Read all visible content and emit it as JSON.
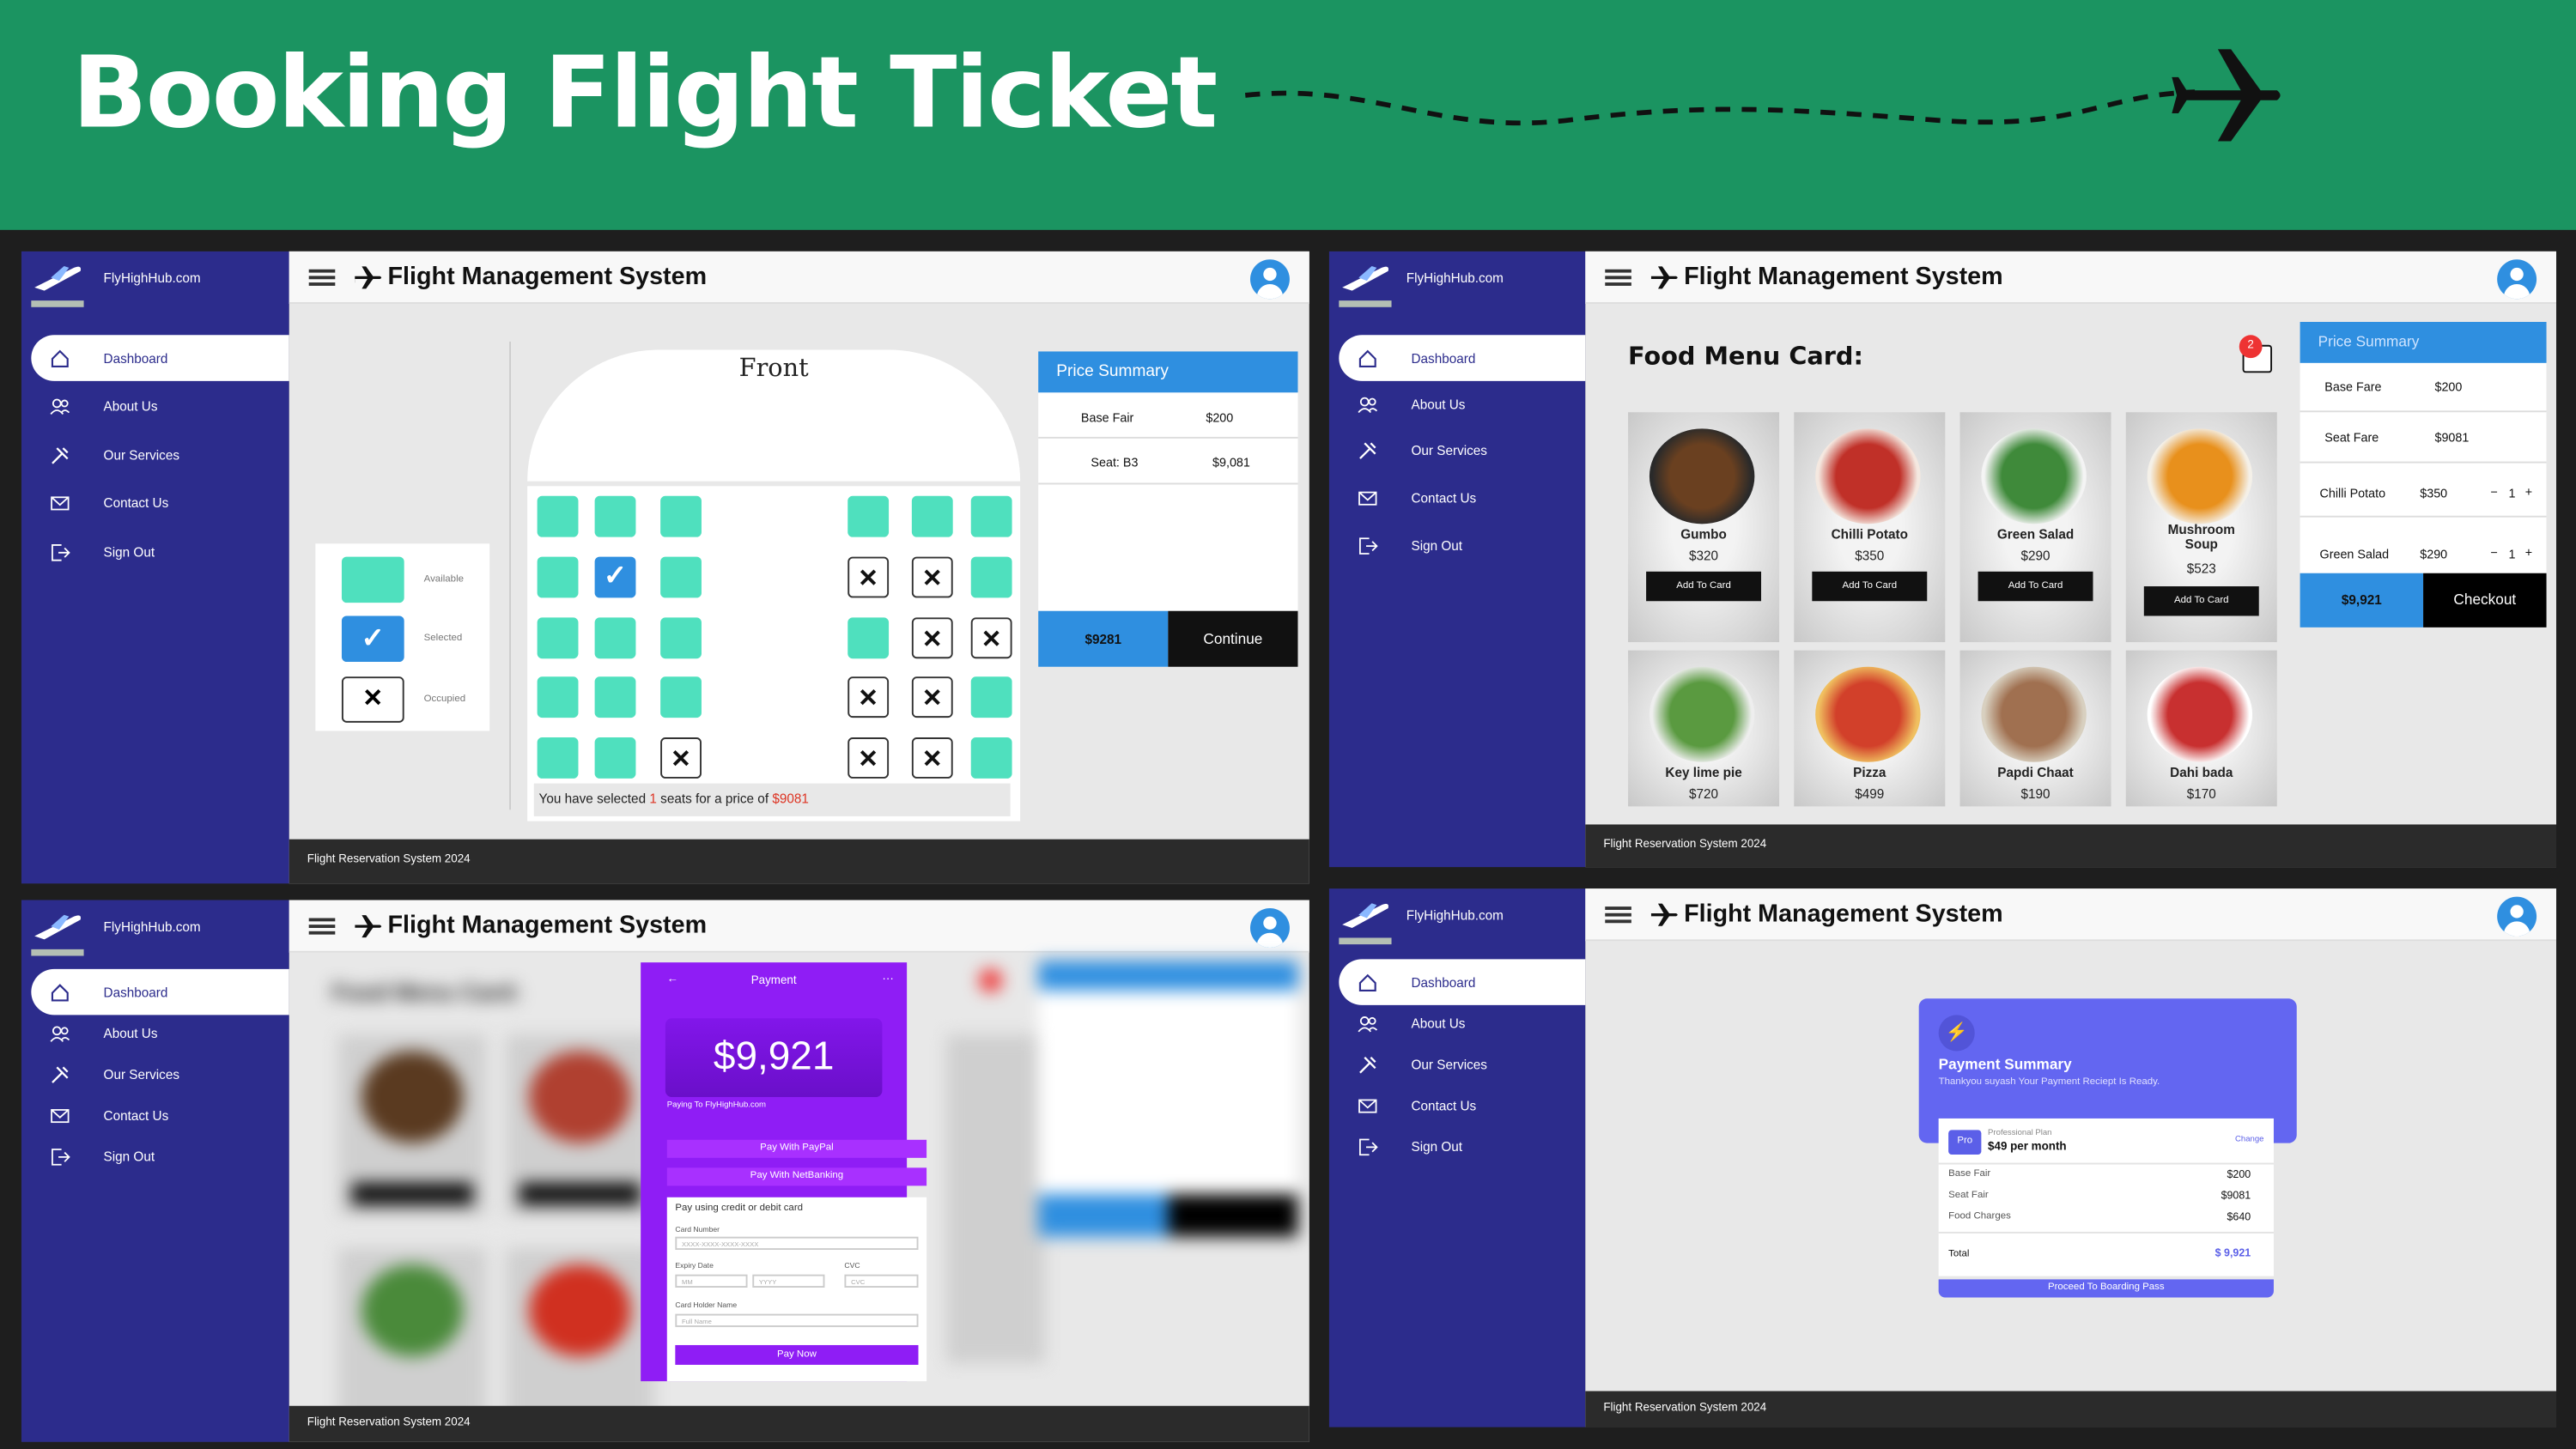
{
  "banner": {
    "title": "Booking Flight Ticket"
  },
  "app": {
    "brand": "FlyHighHub.com",
    "title": "Flight Management System",
    "footer": "Flight Reservation System 2024",
    "nav": [
      "Dashboard",
      "About Us",
      "Our Services",
      "Contact Us",
      "Sign Out"
    ],
    "nav_icons": [
      "home-icon",
      "users-icon",
      "tools-icon",
      "mail-icon",
      "sign-out-icon"
    ]
  },
  "seat_screen": {
    "front_label": "Front",
    "legend": {
      "available": "Available",
      "selected": "Selected",
      "occupied": "Occupied"
    },
    "note": {
      "prefix": "You have selected",
      "count": "1",
      "middle": "seats for a price of",
      "price": "$9081"
    },
    "summary": {
      "title": "Price Summary",
      "base_label": "Base Fair",
      "base_value": "$200",
      "seat_label": "Seat: B3",
      "seat_value": "$9,081",
      "total": "$9281",
      "continue": "Continue"
    }
  },
  "food_screen": {
    "heading": "Food Menu Card:",
    "cart_count": "2",
    "add_label": "Add To Card",
    "items": [
      {
        "name": "Gumbo",
        "price": "$320"
      },
      {
        "name": "Chilli Potato",
        "price": "$350"
      },
      {
        "name": "Green Salad",
        "price": "$290"
      },
      {
        "name": "Mushroom Soup",
        "price": "$523"
      },
      {
        "name": "Key lime pie",
        "price": "$720"
      },
      {
        "name": "Pizza",
        "price": "$499"
      },
      {
        "name": "Papdi Chaat",
        "price": "$190"
      },
      {
        "name": "Dahi bada",
        "price": "$170"
      }
    ],
    "summary": {
      "title": "Price Summary",
      "base_label": "Base Fare",
      "base_value": "$200",
      "seat_label": "Seat Fare",
      "seat_value": "$9081",
      "item1_label": "Chilli Potato",
      "item1_value": "$350",
      "item1_qty": "1",
      "item2_label": "Green Salad",
      "item2_value": "$290",
      "item2_qty": "1",
      "total": "$9,921",
      "checkout": "Checkout"
    }
  },
  "payment_screen": {
    "back": "←",
    "title": "Payment",
    "more": "···",
    "amount": "$9,921",
    "paying_to": "Paying To FlyHighHub.com",
    "paypal": "Pay With PayPal",
    "netbanking": "Pay With NetBanking",
    "card_heading": "Pay using credit or debit card",
    "card_number_label": "Card Number",
    "card_number_ph": "XXXX-XXXX-XXXX-XXXX",
    "expiry_label": "Expiry Date",
    "mm_ph": "MM",
    "yyyy_ph": "YYYY",
    "cvc_label": "CVC",
    "cvc_ph": "CVC",
    "holder_label": "Card Holder Name",
    "holder_ph": "Full Name",
    "pay_now": "Pay Now"
  },
  "receipt_screen": {
    "title": "Payment Summary",
    "subtitle": "Thankyou suyash Your Payment Reciept Is Ready.",
    "pro_badge": "Pro",
    "plan_label": "Professional Plan",
    "plan_price": "$49 per month",
    "change": "Change",
    "rows": [
      {
        "label": "Base Fair",
        "value": "$200"
      },
      {
        "label": "Seat Fair",
        "value": "$9081"
      },
      {
        "label": "Food Charges",
        "value": "$640"
      }
    ],
    "total_label": "Total",
    "total_value": "$ 9,921",
    "proceed": "Proceed To Boarding Pass"
  }
}
